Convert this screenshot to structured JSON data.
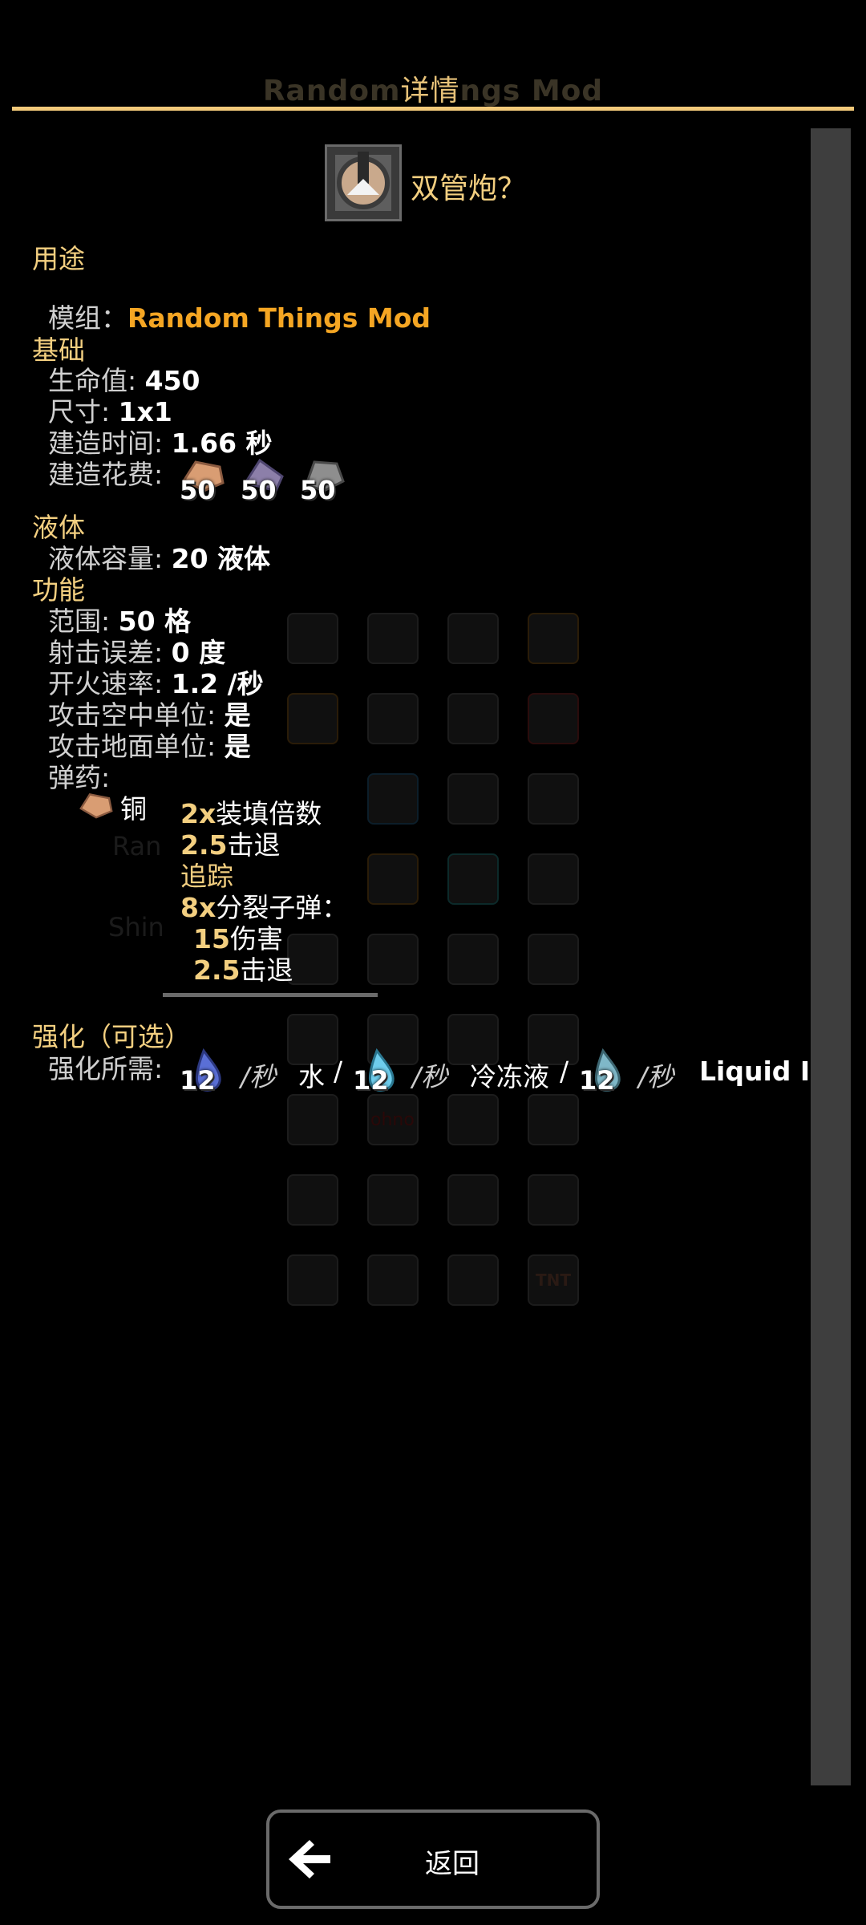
{
  "window": {
    "title_ghost_left": "Random",
    "title_main": "详情",
    "title_ghost_right": "ngs Mod"
  },
  "header": {
    "block_name": "双管炮？",
    "icon": "double-barrel-turret-icon"
  },
  "sections": {
    "usage": "用途",
    "base": "基础",
    "liquid": "液体",
    "function": "功能",
    "boost": "强化（可选）"
  },
  "mod": {
    "label": "模组：",
    "value": "Random Things Mod"
  },
  "stats": {
    "health_label": "生命值:",
    "health_value": "450",
    "size_label": "尺寸:",
    "size_value": "1x1",
    "build_time_label": "建造时间:",
    "build_time_value": "1.66 秒",
    "build_cost_label": "建造花费:",
    "costs": [
      {
        "icon": "copper-icon",
        "amount": "50",
        "color": "#d99d73"
      },
      {
        "icon": "lead-icon",
        "amount": "50",
        "color": "#8c7fa9"
      },
      {
        "icon": "graphite-icon",
        "amount": "50",
        "color": "#8e8e8e"
      }
    ],
    "liquid_capacity_label": "液体容量:",
    "liquid_capacity_value": "20 液体",
    "range_label": "范围:",
    "range_value": "50 格",
    "inaccuracy_label": "射击误差:",
    "inaccuracy_value": "0 度",
    "fire_rate_label": "开火速率:",
    "fire_rate_value": "1.2 /秒",
    "targets_air_label": "攻击空中单位:",
    "targets_air_value": "是",
    "targets_ground_label": "攻击地面单位:",
    "targets_ground_value": "是",
    "ammo_label": "弹药:"
  },
  "ammo": {
    "item_icon": "copper-icon",
    "item_name": "铜",
    "reload_mult": "2x",
    "reload_mult_text": "装填倍数",
    "knockback": "2.5",
    "knockback_text": "击退",
    "homing": "追踪",
    "frag_count": "8x",
    "frag_text": "分裂子弹：",
    "frag_damage": "15",
    "frag_damage_text": "伤害",
    "frag_knockback": "2.5",
    "frag_knockback_text": "击退"
  },
  "boost": {
    "label": "强化所需:",
    "liquids": [
      {
        "icon": "water-drop-icon",
        "amount": "12",
        "rate": "/秒",
        "name": "水",
        "sep": "/",
        "color": "#5a6fd6"
      },
      {
        "icon": "cryofluid-drop-icon",
        "amount": "12",
        "rate": "/秒",
        "name": "冷冻液",
        "sep": "/",
        "color": "#6ecdec"
      },
      {
        "icon": "liquid-drop-icon",
        "amount": "12",
        "rate": "/秒",
        "name": "Liquid I",
        "color": "#7fb8c8"
      }
    ]
  },
  "background_ghost": {
    "texts": [
      "Ran",
      "Shin",
      "ohno"
    ],
    "tnt_label": "TNT"
  },
  "footer": {
    "back_label": "返回",
    "back_icon": "arrow-left-icon"
  }
}
